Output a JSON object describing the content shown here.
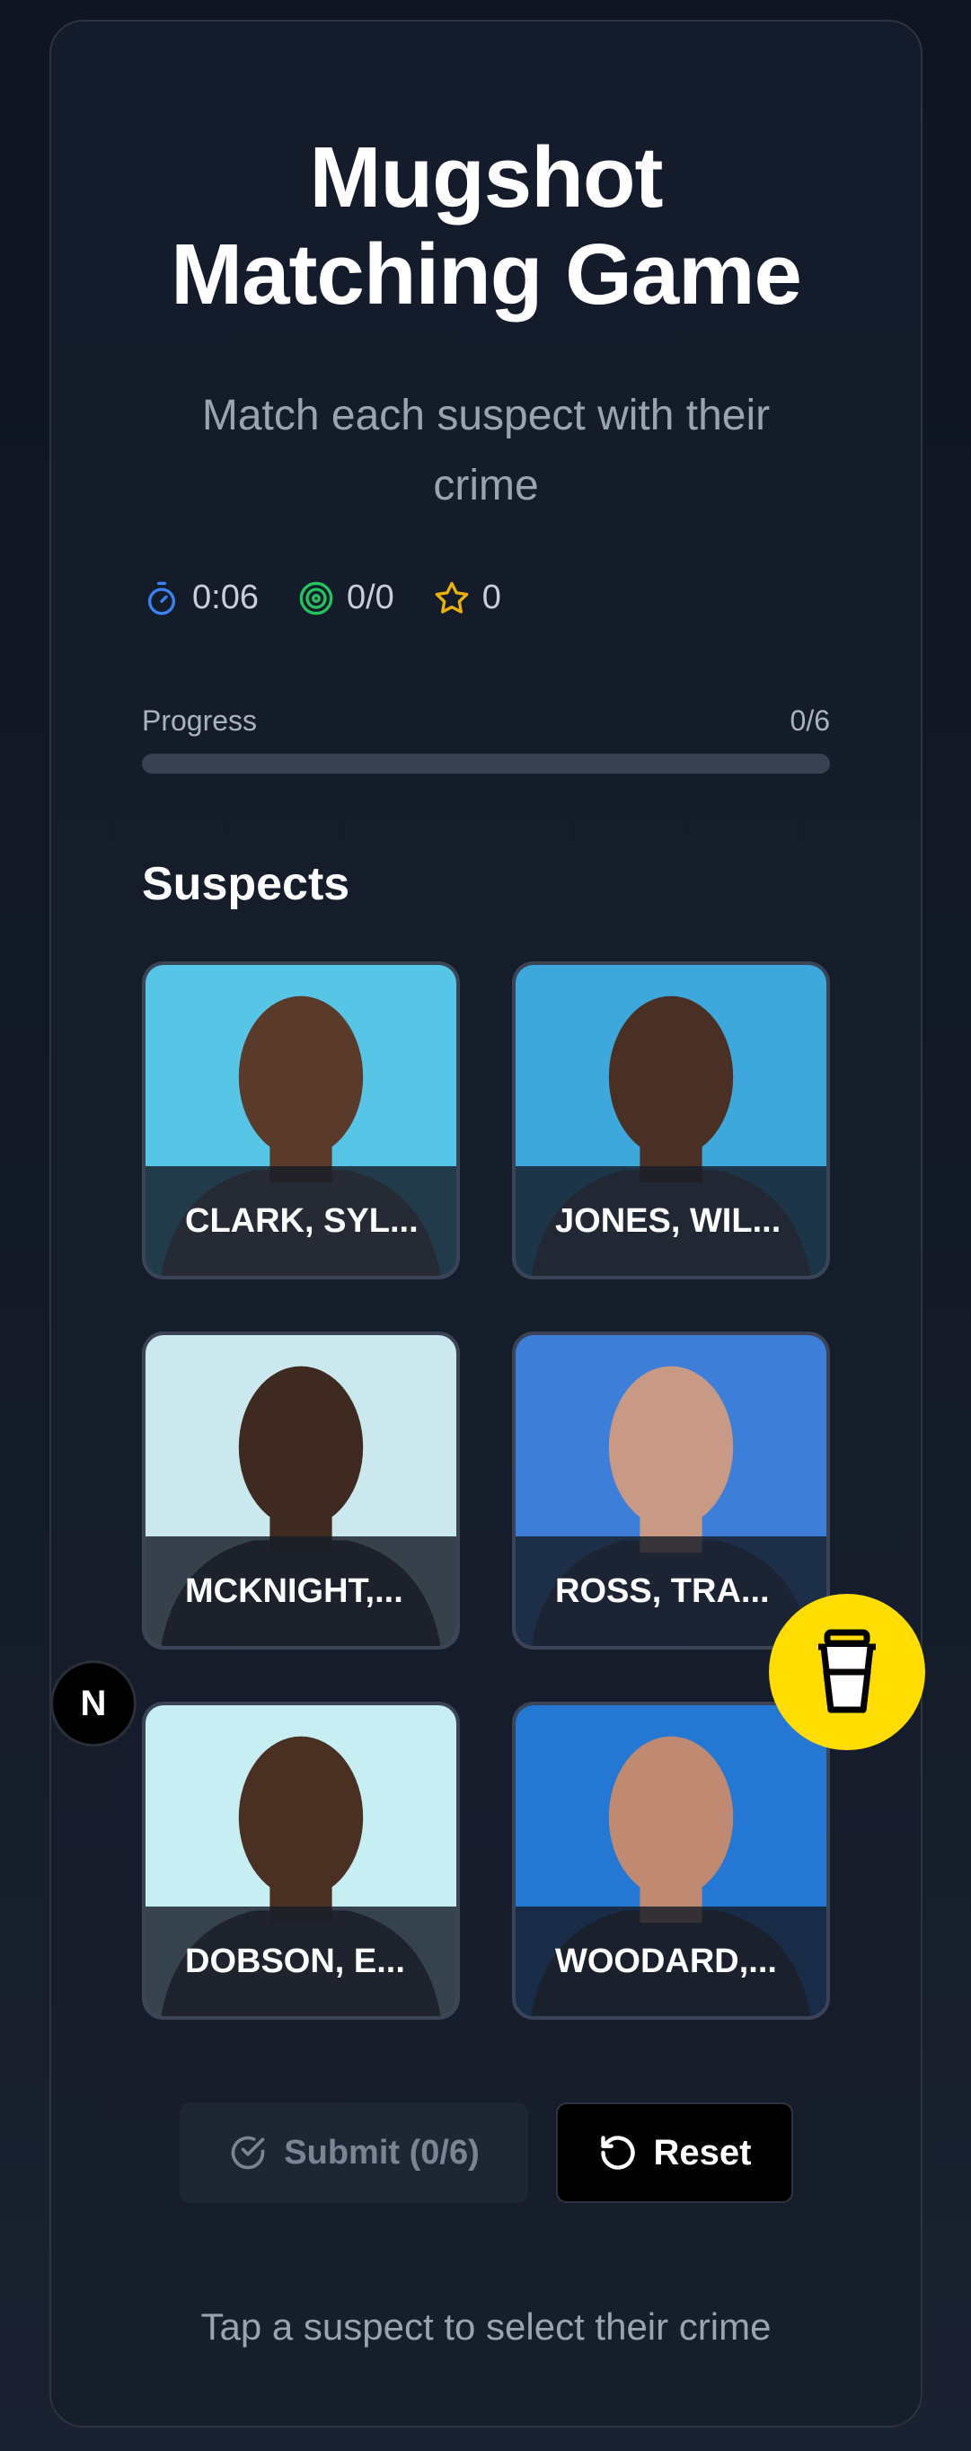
{
  "header": {
    "title_line1": "Mugshot",
    "title_line2": "Matching Game",
    "subtitle": "Match each suspect with their crime"
  },
  "stats": {
    "timer": "0:06",
    "score": "0/0",
    "stars": "0",
    "timer_icon": "timer-icon",
    "target_icon": "target-icon",
    "star_icon": "star-icon"
  },
  "progress": {
    "label": "Progress",
    "count": "0/6",
    "fraction": 0
  },
  "suspects": {
    "heading": "Suspects",
    "items": [
      {
        "name": "CLARK, SYL...",
        "bg": "#57c6e6"
      },
      {
        "name": "JONES, WIL...",
        "bg": "#3ea8dd"
      },
      {
        "name": "MCKNIGHT,...",
        "bg": "#cbe8ee"
      },
      {
        "name": "ROSS, TRA...",
        "bg": "#3d7fd8"
      },
      {
        "name": "DOBSON, E...",
        "bg": "#c7eef3"
      },
      {
        "name": "WOODARD,...",
        "bg": "#2577d4"
      }
    ]
  },
  "actions": {
    "submit_label": "Submit (0/6)",
    "reset_label": "Reset"
  },
  "hint": "Tap a suspect to select their crime",
  "floating": {
    "n_badge": "N",
    "coffee_icon": "coffee-cup-icon",
    "coffee_color": "#ffdd00"
  },
  "colors": {
    "background": "#111827",
    "card_border": "#2c3444",
    "timer_icon": "#3b82f6",
    "target_icon": "#22c55e",
    "star_icon": "#eab308"
  }
}
